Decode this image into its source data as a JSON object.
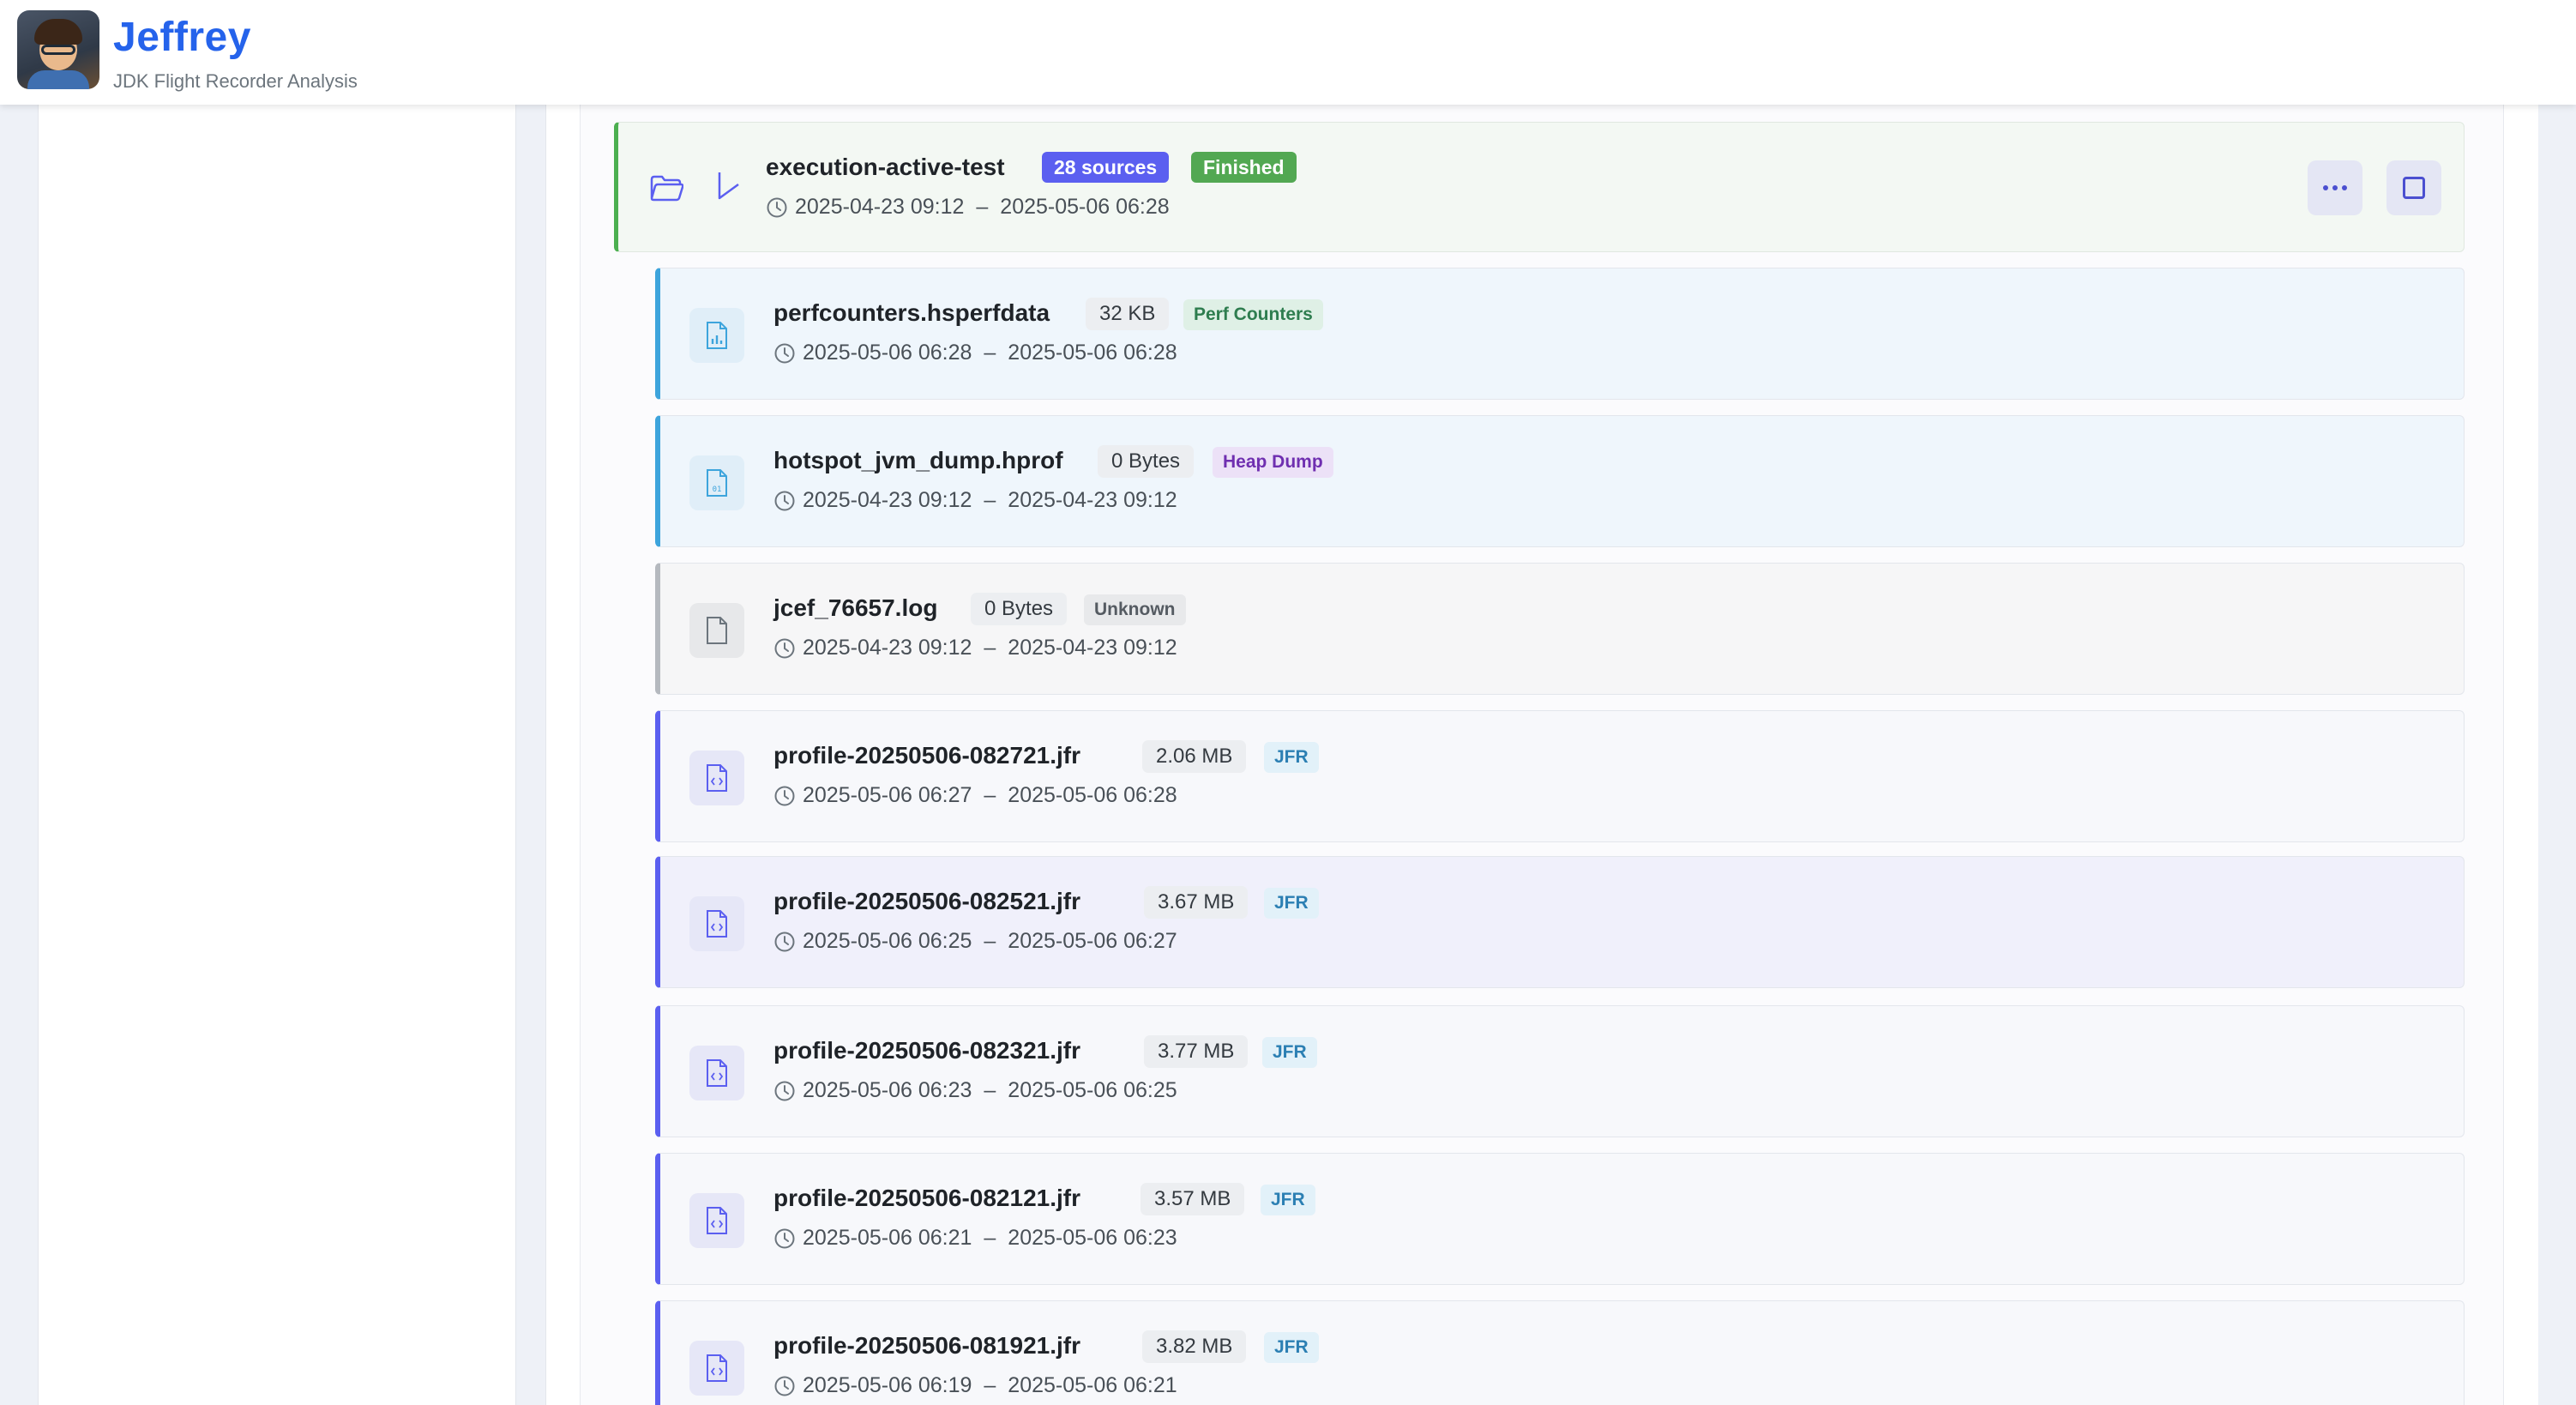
{
  "header": {
    "app_title": "Jeffrey",
    "app_subtitle": "JDK Flight Recorder Analysis"
  },
  "group": {
    "name": "execution-active-test",
    "sources_badge": "28 sources",
    "status_badge": "Finished",
    "start": "2025-04-23 09:12",
    "separator": "–",
    "end": "2025-05-06 06:28",
    "folder_icon": "folder-open-icon",
    "collapse_icon": "chevron-icon",
    "more_icon": "ellipsis-icon",
    "select_icon": "checkbox-icon"
  },
  "colors": {
    "brand": "#2563eb",
    "sources_badge": "#5b5ff0",
    "finished_badge": "#52a852",
    "jfr_accent": "#5b5ff0",
    "perf_accent": "#3da4dc",
    "group_accent": "#4caf50"
  },
  "files": [
    {
      "name": "perfcounters.hsperfdata",
      "size": "32 KB",
      "type": "Perf Counters",
      "start": "2025-05-06 06:28",
      "sep": "–",
      "end": "2025-05-06 06:28",
      "icon": "chart-file-icon"
    },
    {
      "name": "hotspot_jvm_dump.hprof",
      "size": "0 Bytes",
      "type": "Heap Dump",
      "start": "2025-04-23 09:12",
      "sep": "–",
      "end": "2025-04-23 09:12",
      "icon": "binary-file-icon"
    },
    {
      "name": "jcef_76657.log",
      "size": "0 Bytes",
      "type": "Unknown",
      "start": "2025-04-23 09:12",
      "sep": "–",
      "end": "2025-04-23 09:12",
      "icon": "file-icon"
    },
    {
      "name": "profile-20250506-082721.jfr",
      "size": "2.06 MB",
      "type": "JFR",
      "start": "2025-05-06 06:27",
      "sep": "–",
      "end": "2025-05-06 06:28",
      "icon": "code-file-icon"
    },
    {
      "name": "profile-20250506-082521.jfr",
      "size": "3.67 MB",
      "type": "JFR",
      "start": "2025-05-06 06:25",
      "sep": "–",
      "end": "2025-05-06 06:27",
      "icon": "code-file-icon"
    },
    {
      "name": "profile-20250506-082321.jfr",
      "size": "3.77 MB",
      "type": "JFR",
      "start": "2025-05-06 06:23",
      "sep": "–",
      "end": "2025-05-06 06:25",
      "icon": "code-file-icon"
    },
    {
      "name": "profile-20250506-082121.jfr",
      "size": "3.57 MB",
      "type": "JFR",
      "start": "2025-05-06 06:21",
      "sep": "–",
      "end": "2025-05-06 06:23",
      "icon": "code-file-icon"
    },
    {
      "name": "profile-20250506-081921.jfr",
      "size": "3.82 MB",
      "type": "JFR",
      "start": "2025-05-06 06:19",
      "sep": "–",
      "end": "2025-05-06 06:21",
      "icon": "code-file-icon"
    }
  ]
}
